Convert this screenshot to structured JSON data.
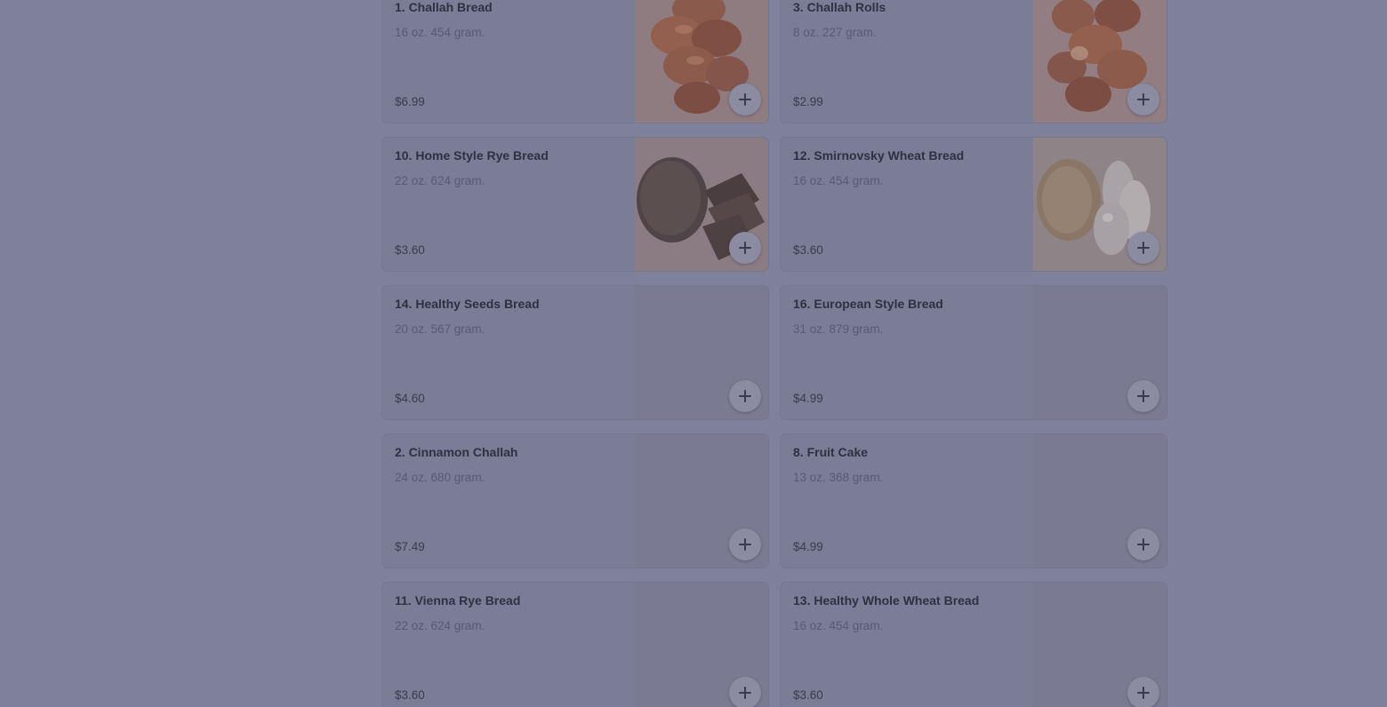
{
  "menu": {
    "items": [
      {
        "title": "1. Challah Bread",
        "size": "16 oz. 454 gram.",
        "price": "$6.99",
        "image": "challah"
      },
      {
        "title": "3. Challah Rolls",
        "size": "8 oz. 227 gram.",
        "price": "$2.99",
        "image": "rolls"
      },
      {
        "title": "10. Home Style Rye Bread",
        "size": "22 oz. 624 gram.",
        "price": "$3.60",
        "image": "rye"
      },
      {
        "title": "12. Smirnovsky Wheat Bread",
        "size": "16 oz. 454 gram.",
        "price": "$3.60",
        "image": "wheat"
      },
      {
        "title": "14. Healthy Seeds Bread",
        "size": "20 oz. 567 gram.",
        "price": "$4.60",
        "image": "none"
      },
      {
        "title": "16. European Style Bread",
        "size": "31 oz. 879 gram.",
        "price": "$4.99",
        "image": "none"
      },
      {
        "title": "2. Cinnamon Challah",
        "size": "24 oz. 680 gram.",
        "price": "$7.49",
        "image": "none"
      },
      {
        "title": "8. Fruit Cake",
        "size": "13 oz. 368 gram.",
        "price": "$4.99",
        "image": "none"
      },
      {
        "title": "11. Vienna Rye Bread",
        "size": "22 oz. 624 gram.",
        "price": "$3.60",
        "image": "none"
      },
      {
        "title": "13. Healthy Whole Wheat Bread",
        "size": "16 oz. 454 gram.",
        "price": "$3.60",
        "image": "none"
      }
    ],
    "add_icon": "plus-icon"
  },
  "colors": {
    "overlay": "#7f8099",
    "card": "#7b7c95",
    "title_text": "#2f3044"
  }
}
